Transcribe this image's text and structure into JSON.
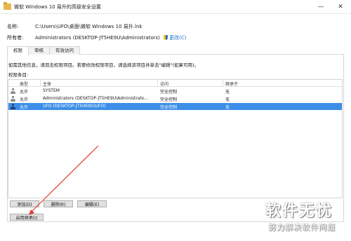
{
  "window": {
    "title": "微软 Windows 10 易升的高级安全设置",
    "minimize_glyph": "—",
    "close_glyph": "✕"
  },
  "info": {
    "name_label": "名称:",
    "name_value": "C:\\Users\\UFO\\桌面\\微软 Windows 10 易升.lnk",
    "owner_label": "所有者:",
    "owner_value": "Administrators (DESKTOP-JT5HE9U\\Administrators)",
    "change_link": "更改(C)"
  },
  "tabs": [
    {
      "label": "权限",
      "active": true
    },
    {
      "label": "审核",
      "active": false
    },
    {
      "label": "有效访问",
      "active": false
    }
  ],
  "instructions": "如需其他信息，请双击权限项目。若要修改权限项目，请选择该项目并单击\"编辑\"(如果可用)。",
  "entries_label": "权限条目:",
  "table": {
    "headers": [
      "类型",
      "主体",
      "访问",
      "继承于"
    ],
    "rows": [
      {
        "type": "允许",
        "principal": "SYSTEM",
        "access": "完全控制",
        "inherited": "无",
        "selected": false
      },
      {
        "type": "允许",
        "principal": "Administrators (DESKTOP-JT5HE9U\\Administrato...",
        "access": "完全控制",
        "inherited": "无",
        "selected": false
      },
      {
        "type": "允许",
        "principal": "UFO (DESKTOP-JT5HE9U\\UFO)",
        "access": "完全控制",
        "inherited": "无",
        "selected": true
      }
    ]
  },
  "buttons": {
    "add": "添加(D)",
    "remove": "删除(R)",
    "edit": "编辑(E)",
    "enable_inheritance": "启用继承(I)"
  },
  "annotation_color": "#e03a2f",
  "selection_color": "#3c8ee8",
  "watermark": {
    "title": "软件无忧",
    "subtitle": "努力解决软件问题"
  }
}
